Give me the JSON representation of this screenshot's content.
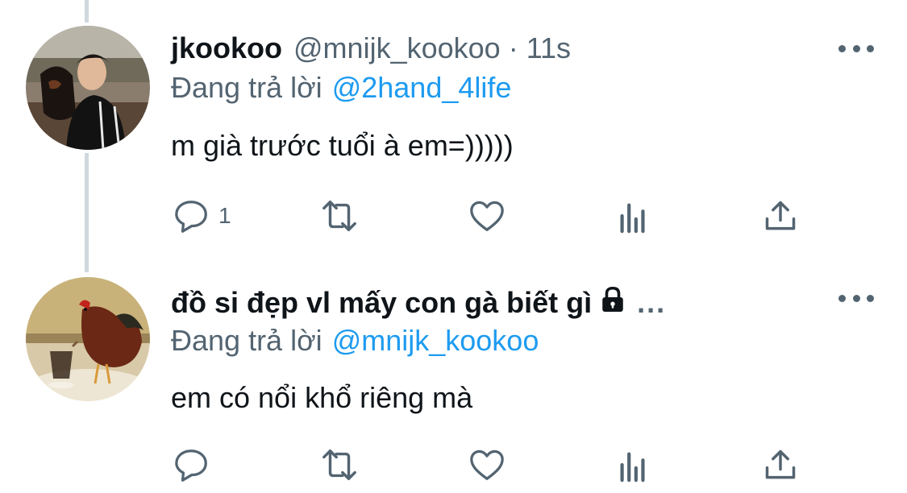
{
  "tweets": [
    {
      "display_name": "jkookoo",
      "handle": "@mnijk_kookoo",
      "dot": "·",
      "time": "11s",
      "replying_label": "Đang trả lời",
      "replying_to": "@2hand_4life",
      "text": "m già trước tuổi à em=)))))",
      "reply_count": "1",
      "avatar_icon": "profile-photo-man-with-dog"
    },
    {
      "display_name": "đồ si đẹp vl mấy con gà biết gì",
      "ellipsis": "...",
      "protected_icon": "lock-icon",
      "replying_label": "Đang trả lời",
      "replying_to": "@mnijk_kookoo",
      "text": "em có nổi khổ riêng mà",
      "reply_count": "",
      "avatar_icon": "profile-photo-rooster-pouring-coffee"
    }
  ],
  "colors": {
    "text_primary": "#0f1419",
    "text_secondary": "#536471",
    "accent": "#1d9bf0",
    "thread_line": "#cfd9de"
  },
  "action_icons": [
    "reply-icon",
    "retweet-icon",
    "like-icon",
    "analytics-icon",
    "share-icon"
  ]
}
